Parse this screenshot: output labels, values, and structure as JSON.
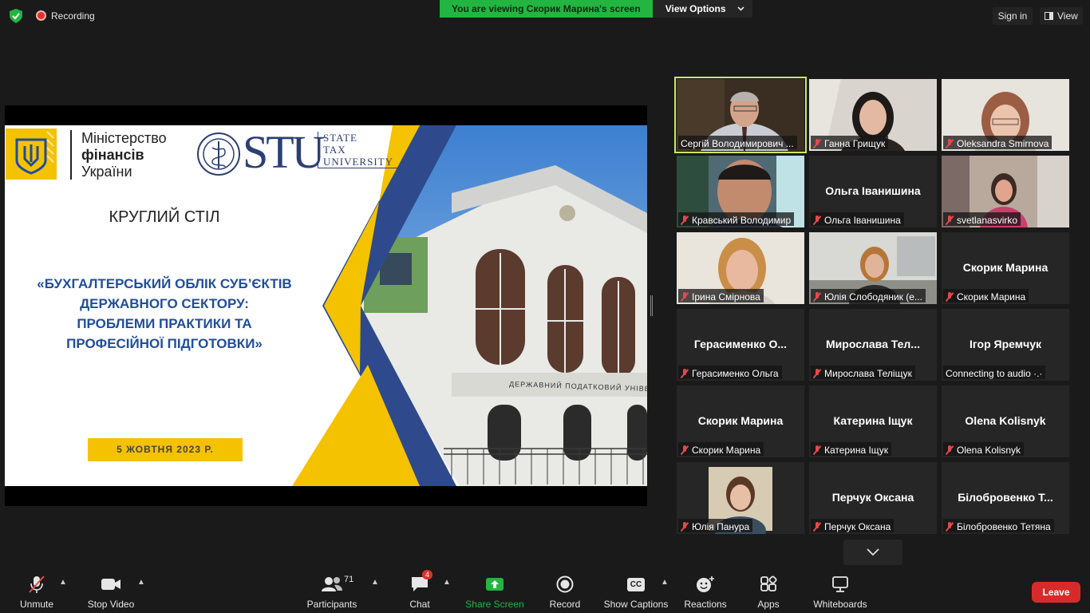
{
  "topbar": {
    "recording_label": "Recording",
    "viewing_banner": "You are viewing Скорик Марина's screen",
    "view_options_label": "View Options",
    "sign_in_label": "Sign in",
    "view_label": "View"
  },
  "slide": {
    "ministry_line1": "Міністерство",
    "ministry_line2": "фінансів",
    "ministry_line3": "України",
    "stu_logo": "STU",
    "stu_sub_line1": "STATE",
    "stu_sub_line2": "TAX",
    "stu_sub_line3": "UNIVERSITY",
    "round_table": "КРУГЛИЙ СТІЛ",
    "topic_line1": "«БУХГАЛТЕРСЬКИЙ ОБЛІК СУБ’ЄКТІВ",
    "topic_line2": "ДЕРЖАВНОГО СЕКТОРУ:",
    "topic_line3": "ПРОБЛЕМИ ПРАКТИКИ ТА",
    "topic_line4": "ПРОФЕСІЙНОЇ ПІДГОТОВКИ»",
    "date": "5 ЖОВТНЯ 2023 Р.",
    "building_sign": "ДЕРЖАВНИЙ ПОДАТКОВИЙ УНІВЕРСИТ"
  },
  "participants": [
    {
      "label": "Сергій Володимирович ...",
      "muted": false,
      "video": true
    },
    {
      "label": "Ганна Грищук",
      "muted": true,
      "video": true
    },
    {
      "label": "Oleksandra Smirnova",
      "muted": true,
      "video": true
    },
    {
      "label": "Кравський Володимир",
      "muted": true,
      "video": true
    },
    {
      "label": "Ольга Іванишина",
      "center": "Ольга Іванишина",
      "muted": true,
      "video": false
    },
    {
      "label": "svetlanasvirko",
      "muted": true,
      "video": true
    },
    {
      "label": "Ірина Смірнова",
      "muted": true,
      "video": true
    },
    {
      "label": "Юлія Слободяник (е...",
      "muted": true,
      "video": true
    },
    {
      "label": "Скорик Марина",
      "center": "Скорик Марина",
      "muted": true,
      "video": false
    },
    {
      "label": "Герасименко Ольга",
      "center": "Герасименко О...",
      "muted": true,
      "video": false
    },
    {
      "label": "Мирослава Теліщук",
      "center": "Мирослава Тел...",
      "muted": true,
      "video": false
    },
    {
      "label": "Connecting to audio ·.·",
      "center": "Ігор Яремчук",
      "muted": false,
      "video": false
    },
    {
      "label": "Скорик Марина",
      "center": "Скорик Марина",
      "muted": true,
      "video": false
    },
    {
      "label": "Катерина Іщук",
      "center": "Катерина Іщук",
      "muted": true,
      "video": false
    },
    {
      "label": "Olena Kolisnyk",
      "center": "Olena Kolisnyk",
      "muted": true,
      "video": false
    },
    {
      "label": "Юлія Панура",
      "muted": true,
      "video": true
    },
    {
      "label": "Перчук Оксана",
      "center": "Перчук Оксана",
      "muted": true,
      "video": false
    },
    {
      "label": "Білобровенко Тетяна",
      "center": "Білобровенко Т...",
      "muted": true,
      "video": false
    }
  ],
  "toolbar": {
    "unmute": "Unmute",
    "stop_video": "Stop Video",
    "participants": "Participants",
    "participants_count": "71",
    "chat": "Chat",
    "chat_badge": "4",
    "share_screen": "Share Screen",
    "record": "Record",
    "show_captions": "Show Captions",
    "captions_icon": "CC",
    "reactions": "Reactions",
    "apps": "Apps",
    "whiteboards": "Whiteboards",
    "leave": "Leave"
  },
  "colors": {
    "background": "#1a1a1a",
    "banner_green": "#23b541",
    "active_speaker": "#c9e865",
    "share_green": "#23b541",
    "leave_red": "#d72b2b",
    "slide_yellow": "#f5c200",
    "slide_navy": "#2c3f73",
    "slide_blue_text": "#204e9b"
  }
}
